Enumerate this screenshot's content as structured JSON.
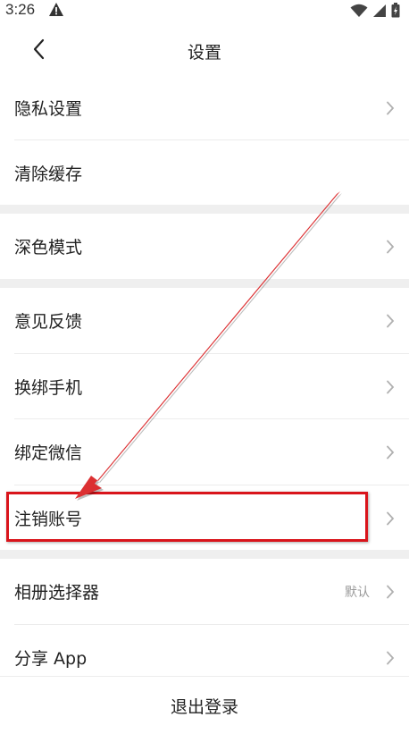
{
  "status_bar": {
    "time": "3:26"
  },
  "header": {
    "title": "设置"
  },
  "settings": {
    "privacy": "隐私设置",
    "clear_cache": "清除缓存",
    "dark_mode": "深色模式",
    "feedback": "意见反馈",
    "change_phone": "换绑手机",
    "bind_wechat": "绑定微信",
    "delete_account": "注销账号",
    "album_picker": "相册选择器",
    "album_picker_value": "默认",
    "share_app": "分享 App"
  },
  "footer": {
    "logout": "退出登录"
  },
  "colors": {
    "annotation": "#d9141b",
    "separator": "#efefef",
    "chevron": "#b0b0b0"
  }
}
